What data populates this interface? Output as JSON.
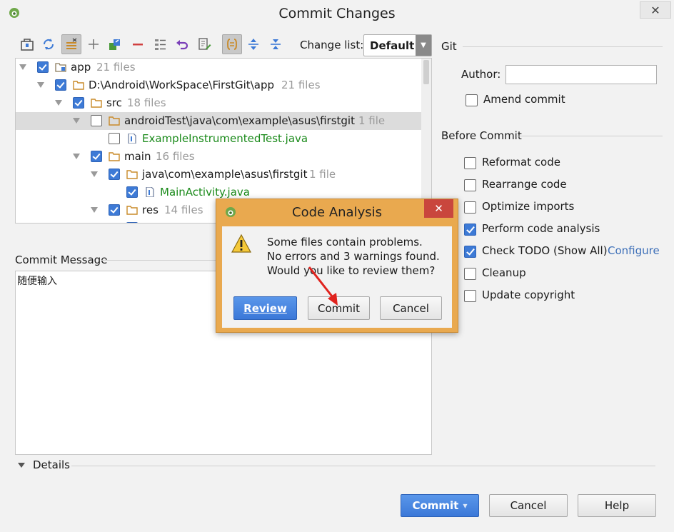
{
  "window": {
    "title": "Commit Changes",
    "close_glyph": "✕"
  },
  "toolbar": {
    "icons": [
      "diff-icon",
      "refresh-icon",
      "group-icon",
      "add-icon",
      "move-icon",
      "remove-icon",
      "list-icon",
      "revert-icon",
      "edit-icon",
      "expand-collapse-icon",
      "expand-all-icon",
      "collapse-all-icon"
    ],
    "changelist_label": "Change list:",
    "changelist_value": "Default"
  },
  "tree": {
    "rows": [
      {
        "name": "app",
        "count": "21 files",
        "checked": true,
        "green": false
      },
      {
        "name": "D:\\Android\\WorkSpace\\FirstGit\\app",
        "count": "21 files",
        "checked": true,
        "green": false
      },
      {
        "name": "src",
        "count": "18 files",
        "checked": true,
        "green": false
      },
      {
        "name": "androidTest\\java\\com\\example\\asus\\firstgit",
        "count": "1 file",
        "checked": false,
        "green": false
      },
      {
        "name": "ExampleInstrumentedTest.java",
        "count": "",
        "checked": false,
        "green": true
      },
      {
        "name": "main",
        "count": "16 files",
        "checked": true,
        "green": false
      },
      {
        "name": "java\\com\\example\\asus\\firstgit",
        "count": "1 file",
        "checked": true,
        "green": false
      },
      {
        "name": "MainActivity.java",
        "count": "",
        "checked": true,
        "green": true
      },
      {
        "name": "res",
        "count": "14 files",
        "checked": true,
        "green": false
      }
    ]
  },
  "commit_message": {
    "label": "Commit Message",
    "text": "随便输入"
  },
  "details": {
    "label": "Details"
  },
  "git": {
    "section_title": "Git",
    "author_label": "Author:",
    "author_value": "",
    "amend_label": "Amend commit"
  },
  "before_commit": {
    "section_title": "Before Commit",
    "options": [
      {
        "label": "Reformat code",
        "checked": false
      },
      {
        "label": "Rearrange code",
        "checked": false
      },
      {
        "label": "Optimize imports",
        "checked": false
      },
      {
        "label": "Perform code analysis",
        "checked": true
      },
      {
        "label": "Check TODO (Show All)",
        "checked": true,
        "link": "Configure"
      },
      {
        "label": "Cleanup",
        "checked": false
      },
      {
        "label": "Update copyright",
        "checked": false
      }
    ]
  },
  "buttons": {
    "commit": "Commit",
    "cancel": "Cancel",
    "help": "Help"
  },
  "dialog": {
    "title": "Code Analysis",
    "close_glyph": "✕",
    "line1": "Some files contain problems.",
    "line2": "No errors and 3 warnings found.",
    "line3": "Would you like to review them?",
    "review": "Review",
    "commit": "Commit",
    "cancel": "Cancel"
  },
  "colors": {
    "accent": "#3d7ad6",
    "dialog_frame": "#e9a94f",
    "dialog_close": "#c9463d",
    "arrow": "#e0231e",
    "file_green": "#1a8a1a"
  }
}
